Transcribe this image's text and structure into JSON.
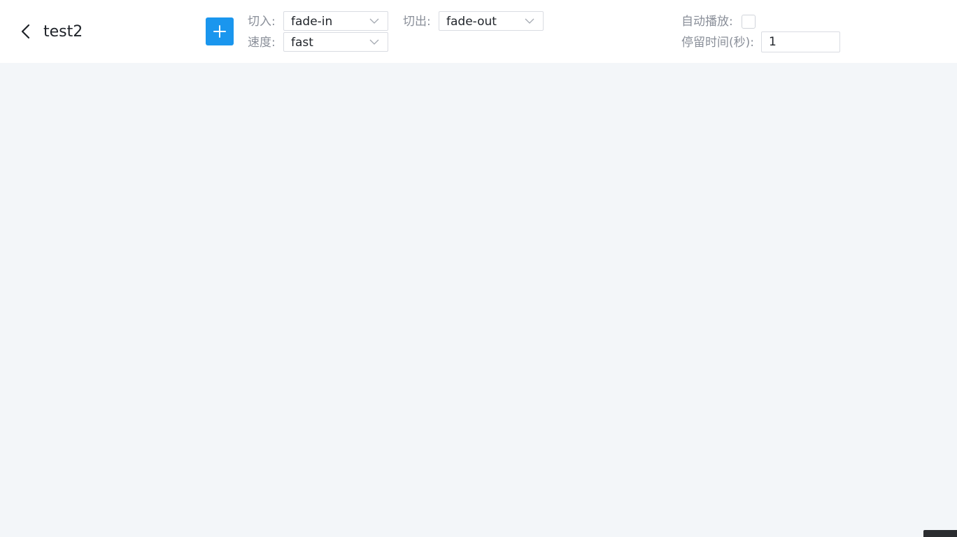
{
  "header": {
    "title": "test2",
    "back_icon": "chevron-left-icon",
    "add_icon": "plus-icon"
  },
  "transition": {
    "in_label": "切入:",
    "in_value": "fade-in",
    "out_label": "切出:",
    "out_value": "fade-out",
    "speed_label": "速度:",
    "speed_value": "fast"
  },
  "playback": {
    "autoplay_label": "自动播放:",
    "autoplay_checked": false,
    "dwell_label": "停留时间(秒):",
    "dwell_value": "1"
  },
  "colors": {
    "accent": "#1a96ee",
    "background": "#f3f6f9",
    "label": "#8a8f99",
    "text": "#1f2329"
  }
}
